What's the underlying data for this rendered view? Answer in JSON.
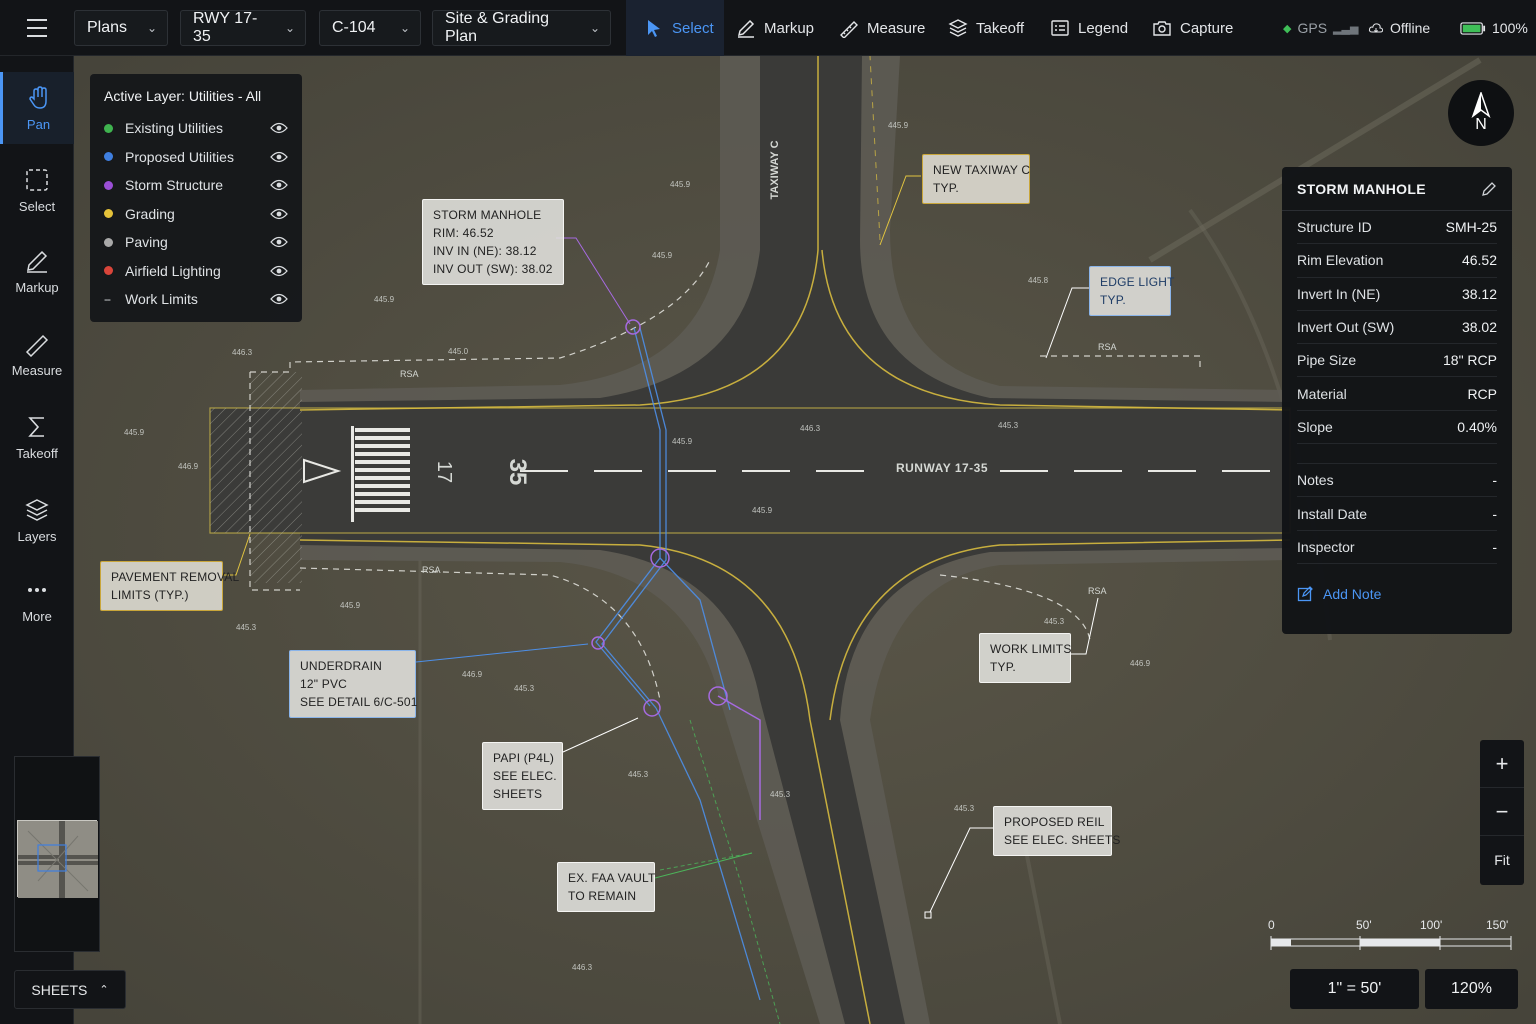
{
  "toolbar": {
    "plans": "Plans",
    "runway": "RWY 17-35",
    "sheet": "C-104",
    "plan_name": "Site & Grading Plan",
    "tools": [
      {
        "label": "Select",
        "icon": "cursor-icon",
        "active": true
      },
      {
        "label": "Markup",
        "icon": "pen-icon"
      },
      {
        "label": "Measure",
        "icon": "ruler-icon"
      },
      {
        "label": "Takeoff",
        "icon": "stack-icon"
      },
      {
        "label": "Legend",
        "icon": "legend-icon"
      },
      {
        "label": "Capture",
        "icon": "camera-icon"
      }
    ],
    "gps": "GPS",
    "offline": "Offline",
    "battery": "100%"
  },
  "rail": {
    "items": [
      {
        "label": "Pan",
        "icon": "hand-icon",
        "active": true
      },
      {
        "label": "Select",
        "icon": "select-box-icon"
      },
      {
        "label": "Markup",
        "icon": "markup-icon"
      },
      {
        "label": "Measure",
        "icon": "measure-icon"
      },
      {
        "label": "Takeoff",
        "icon": "sigma-icon"
      },
      {
        "label": "Layers",
        "icon": "layers-icon"
      },
      {
        "label": "More",
        "icon": "more-icon"
      }
    ]
  },
  "layers": {
    "title": "Active Layer:  Utilities - All",
    "items": [
      {
        "label": "Existing Utilities",
        "color": "#3fb34f"
      },
      {
        "label": "Proposed Utilities",
        "color": "#3f7fe0"
      },
      {
        "label": "Storm Structure",
        "color": "#9b4fd6"
      },
      {
        "label": "Grading",
        "color": "#e5c23a"
      },
      {
        "label": "Paving",
        "color": "#a9a9a9"
      },
      {
        "label": "Airfield Lighting",
        "color": "#d9453a"
      },
      {
        "label": "Work Limits",
        "color": "dashed"
      }
    ]
  },
  "callouts": {
    "storm_mh": [
      "STORM MANHOLE",
      "RIM: 46.52",
      "INV IN (NE): 38.12",
      "INV OUT (SW): 38.02"
    ],
    "new_twy": [
      "NEW TAXIWAY C",
      "TYP."
    ],
    "edge_light": [
      "EDGE LIGHT",
      "TYP."
    ],
    "pavement": [
      "PAVEMENT REMOVAL",
      "LIMITS (TYP.)"
    ],
    "underdrain": [
      "UNDERDRAIN",
      "12\" PVC",
      "SEE DETAIL 6/C-501"
    ],
    "papi": [
      "PAPI (P4L)",
      "SEE ELEC.",
      "SHEETS"
    ],
    "work_limits": [
      "WORK LIMITS",
      "TYP."
    ],
    "reil": [
      "PROPOSED REIL",
      "SEE ELEC. SHEETS"
    ],
    "faa": [
      "EX. FAA VAULT",
      "TO REMAIN"
    ]
  },
  "map_labels": {
    "runway": "RUNWAY 17-35",
    "taxiway": "TAXIWAY C",
    "rsa": "RSA",
    "runway_number_1": "35",
    "runway_number_2": "17",
    "spot_445_9": "445.9",
    "spot_445_3": "445.3",
    "spot_445_8": "445.8",
    "spot_446_3": "446.3",
    "spot_446_9": "446.9",
    "spot_445_0": "445.0"
  },
  "compass": {
    "label": "N"
  },
  "info": {
    "title": "STORM MANHOLE",
    "rows": [
      {
        "k": "Structure ID",
        "v": "SMH-25"
      },
      {
        "k": "Rim Elevation",
        "v": "46.52"
      },
      {
        "k": "Invert In (NE)",
        "v": "38.12"
      },
      {
        "k": "Invert Out (SW)",
        "v": "38.02"
      },
      {
        "k": "Pipe Size",
        "v": "18\" RCP"
      },
      {
        "k": "Material",
        "v": "RCP"
      },
      {
        "k": "Slope",
        "v": "0.40%"
      }
    ],
    "rows2": [
      {
        "k": "Notes",
        "v": "-"
      },
      {
        "k": "Install Date",
        "v": "-"
      },
      {
        "k": "Inspector",
        "v": "-"
      }
    ],
    "add_note": "Add Note"
  },
  "zoom": {
    "plus": "+",
    "minus": "−",
    "fit": "Fit"
  },
  "scale": {
    "labels": [
      "0",
      "50'",
      "100'",
      "150'"
    ],
    "ratio": "1\" = 50'",
    "zoom_level": "120%"
  },
  "sheets": {
    "label": "SHEETS"
  }
}
